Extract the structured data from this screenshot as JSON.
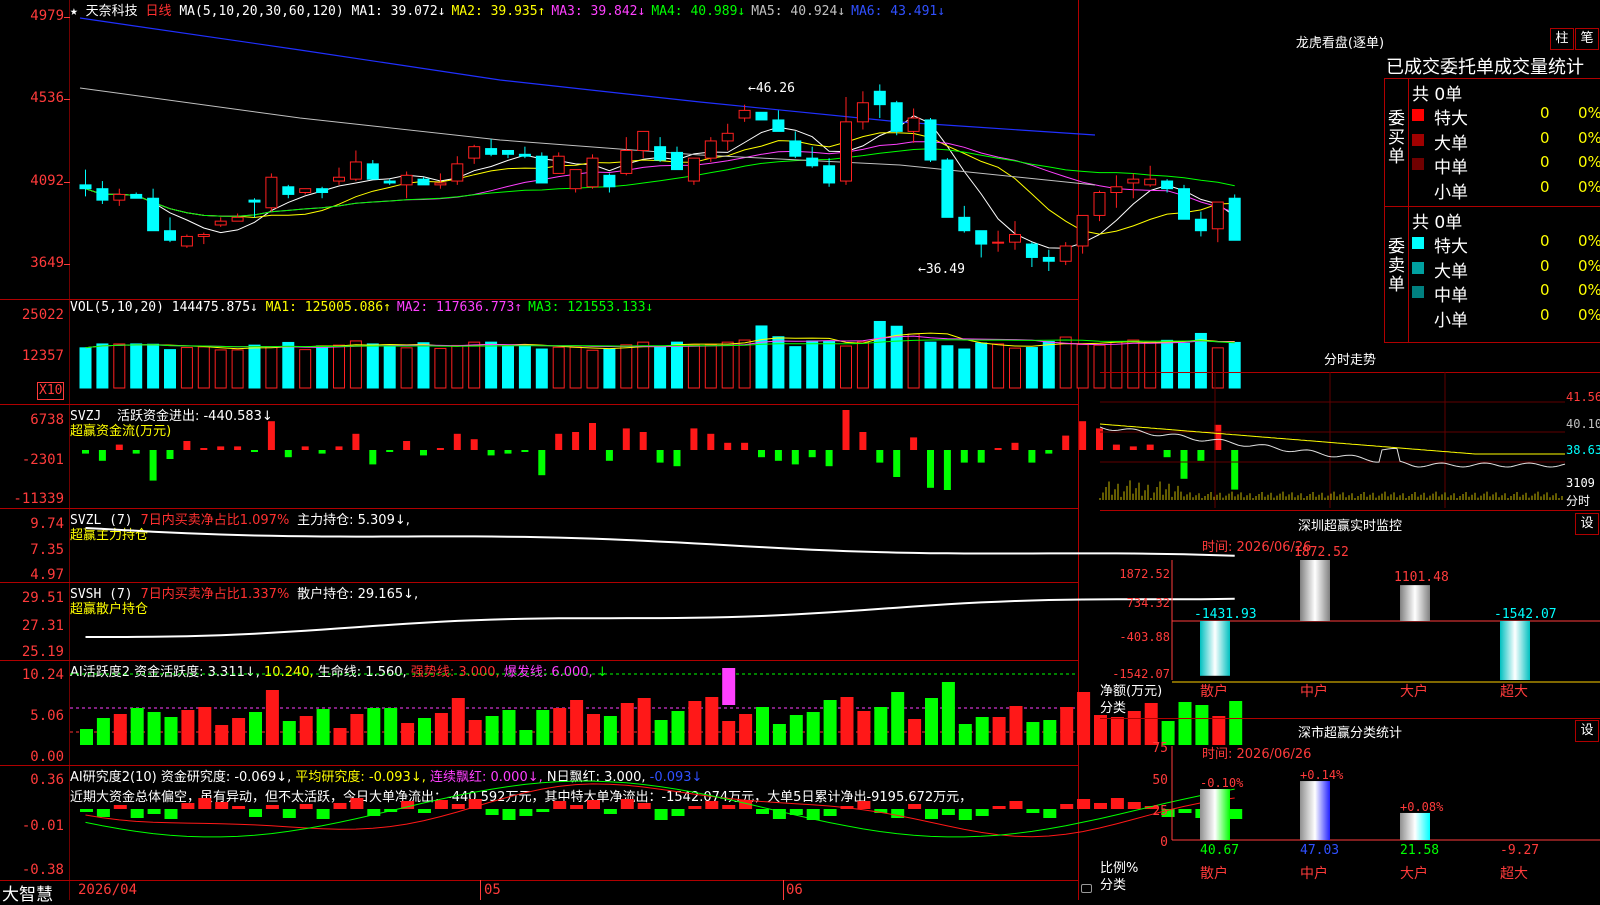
{
  "stock": {
    "name": "天奈科技",
    "period": "日线",
    "star": "★"
  },
  "ma_header": {
    "label": "MA(5,10,20,30,60,120)",
    "items": [
      {
        "text": "MA1: 39.072↓",
        "color": "#ffffff"
      },
      {
        "text": "MA2: 39.935↑",
        "color": "#ffff00"
      },
      {
        "text": "MA3: 39.842↓",
        "color": "#ff40ff"
      },
      {
        "text": "MA4: 40.989↓",
        "color": "#00ff00"
      },
      {
        "text": "MA5: 40.924↓",
        "color": "#c0c0c0"
      },
      {
        "text": "MA6: 43.491↓",
        "color": "#3050ff"
      }
    ]
  },
  "price_axis": [
    "4979",
    "4536",
    "4092",
    "3649"
  ],
  "price_marks": {
    "high": "46.26",
    "low": "36.49"
  },
  "vol_header": {
    "label": "VOL(5,10,20)",
    "value": "144475.875↓",
    "items": [
      {
        "text": "MA1: 125005.086↑",
        "color": "#ffff00"
      },
      {
        "text": "MA2: 117636.773↑",
        "color": "#ff40ff"
      },
      {
        "text": "MA3: 121553.133↓",
        "color": "#00ff00"
      }
    ]
  },
  "vol_axis": [
    "25022",
    "12357"
  ],
  "vol_unit": "X10",
  "svzj": {
    "label": "SVZJ",
    "text": "活跃资金进出: -440.583↓",
    "sub": "超赢资金流(万元)",
    "axis": [
      "6738",
      "-2301",
      "-11339"
    ]
  },
  "svzl": {
    "label": "SVZL (7)",
    "t1": "7日内买卖净占比1.097%",
    "t2": "主力持仓: 5.309↓,",
    "sub": "超赢主力持仓",
    "axis": [
      "9.74",
      "7.35",
      "4.97"
    ]
  },
  "svsh": {
    "label": "SVSH (7)",
    "t1": "7日内买卖净占比1.337%",
    "t2": "散户持仓: 29.165↓,",
    "sub": "超赢散户持仓",
    "axis": [
      "29.51",
      "27.31",
      "25.19"
    ]
  },
  "ai1": {
    "t1": "AI活跃度2 资金活跃度: 3.311↓,",
    "t2": "10.240,",
    "t3": "生命线: 1.560,",
    "t4": "强势线: 3.000,",
    "t5": "爆发线: 6.000,",
    "t6": "↓",
    "axis": [
      "10.24",
      "5.06",
      "0.00"
    ]
  },
  "ai2": {
    "t1": "AI研究度2(10) 资金研究度: -0.069↓,",
    "t2": "平均研究度: -0.093↓,",
    "t3": "连续飘红: 0.000↓,",
    "t4": "N日飘红: 3.000,",
    "t5": "-0.093↓",
    "desc": "近期大资金总体偏空，虽有异动，但不太活跃，今日大单净流出：-440.592万元，其中特大单净流出：-1542.074万元，大单5日累计净出-9195.672万元，",
    "axis": [
      "0.36",
      "-0.01",
      "-0.38"
    ]
  },
  "date_axis": [
    "2026/04",
    "05",
    "06"
  ],
  "brand": "大智慧",
  "right": {
    "lhb_title": "龙虎看盘(逐单)",
    "btn_zhu": "柱",
    "btn_bi": "笔",
    "order_title": "已成交委托单成交量统计",
    "buy": {
      "label": "委买单",
      "total": "共 0单",
      "rows": [
        {
          "name": "特大",
          "v": "0",
          "p": "0%",
          "c": "#ff0000"
        },
        {
          "name": "大单",
          "v": "0",
          "p": "0%",
          "c": "#a00000"
        },
        {
          "name": "中单",
          "v": "0",
          "p": "0%",
          "c": "#700000"
        },
        {
          "name": "小单",
          "v": "0",
          "p": "0%",
          "c": ""
        }
      ]
    },
    "sell": {
      "label": "委卖单",
      "total": "共 0单",
      "rows": [
        {
          "name": "特大",
          "v": "0",
          "p": "0%",
          "c": "#00ffff"
        },
        {
          "name": "大单",
          "v": "0",
          "p": "0%",
          "c": "#00a0a0"
        },
        {
          "name": "中单",
          "v": "0",
          "p": "0%",
          "c": "#008080"
        },
        {
          "name": "小单",
          "v": "0",
          "p": "0%",
          "c": ""
        }
      ]
    },
    "fs_title": "分时走势",
    "fs_axis": [
      "41.56",
      "40.10",
      "38.63"
    ],
    "fs_vol": "3109",
    "fs_unit": "分时",
    "sz_title": "深圳超赢实时监控",
    "set": "设",
    "time": "时间: 2026/06/26",
    "sz_axis": [
      "1872.52",
      "734.32",
      "-403.88",
      "-1542.07"
    ],
    "sz_bars": [
      {
        "cat": "散户",
        "value": "-1431.93"
      },
      {
        "cat": "中户",
        "value": "1872.52"
      },
      {
        "cat": "大户",
        "value": "1101.48"
      },
      {
        "cat": "超大",
        "value": "-1542.07"
      }
    ],
    "sz_ylabel": "净额(万元)",
    "sz_xlabel": "分类",
    "ss_title": "深市超赢分类统计",
    "ss_axis": [
      "75",
      "50",
      "25",
      "0"
    ],
    "ss_bars": [
      {
        "cat": "散户",
        "top": "-0.10%",
        "bottom": "40.67"
      },
      {
        "cat": "中户",
        "top": "+0.14%",
        "bottom": "47.03"
      },
      {
        "cat": "大户",
        "top": "+0.08%",
        "bottom": "21.58"
      },
      {
        "cat": "超大",
        "top": "",
        "bottom": "-9.27"
      }
    ],
    "ss_ylabel": "比例%",
    "ss_xlabel": "分类"
  },
  "chart_data": {
    "type": "candlestick",
    "ohlc": [
      [
        41.0,
        41.8,
        40.4,
        40.8
      ],
      [
        40.8,
        41.2,
        40.0,
        40.2
      ],
      [
        40.2,
        40.8,
        39.9,
        40.5
      ],
      [
        40.5,
        40.6,
        40.3,
        40.3
      ],
      [
        40.3,
        40.8,
        38.6,
        38.6
      ],
      [
        38.6,
        39.3,
        38.0,
        38.1
      ],
      [
        37.8,
        38.4,
        37.7,
        38.3
      ],
      [
        38.3,
        38.5,
        37.9,
        38.4
      ],
      [
        38.9,
        39.3,
        38.8,
        39.1
      ],
      [
        39.1,
        39.5,
        39.1,
        39.3
      ],
      [
        40.2,
        40.3,
        39.3,
        40.1
      ],
      [
        39.8,
        41.6,
        39.6,
        41.4
      ],
      [
        40.9,
        41.0,
        40.3,
        40.5
      ],
      [
        40.6,
        40.8,
        40.5,
        40.8
      ],
      [
        40.8,
        40.9,
        40.3,
        40.6
      ],
      [
        41.2,
        41.9,
        41.0,
        41.4
      ],
      [
        41.3,
        42.8,
        41.2,
        42.2
      ],
      [
        42.1,
        42.3,
        41.3,
        41.3
      ],
      [
        41.2,
        41.3,
        41.0,
        41.1
      ],
      [
        41.0,
        41.7,
        40.3,
        41.5
      ],
      [
        41.3,
        41.4,
        41.0,
        41.0
      ],
      [
        41.0,
        41.6,
        40.8,
        41.1
      ],
      [
        41.2,
        42.5,
        41.0,
        42.1
      ],
      [
        42.4,
        43.1,
        42.1,
        43.0
      ],
      [
        42.9,
        43.4,
        42.5,
        42.6
      ],
      [
        42.8,
        42.8,
        42.4,
        42.6
      ],
      [
        42.6,
        43.0,
        42.4,
        42.5
      ],
      [
        42.5,
        42.7,
        41.1,
        41.1
      ],
      [
        41.6,
        42.7,
        41.6,
        42.5
      ],
      [
        40.8,
        41.7,
        40.6,
        41.8
      ],
      [
        40.9,
        42.6,
        40.8,
        42.4
      ],
      [
        41.5,
        41.6,
        40.6,
        40.9
      ],
      [
        41.6,
        43.5,
        41.5,
        42.8
      ],
      [
        42.8,
        43.6,
        42.4,
        43.8
      ],
      [
        43.0,
        43.5,
        42.2,
        42.3
      ],
      [
        42.7,
        43.0,
        42.1,
        41.8
      ],
      [
        41.2,
        42.3,
        41.0,
        42.4
      ],
      [
        42.4,
        43.5,
        42.2,
        43.3
      ],
      [
        43.3,
        44.2,
        42.8,
        43.7
      ],
      [
        44.5,
        45.2,
        44.3,
        44.9
      ],
      [
        44.8,
        44.8,
        44.4,
        44.4
      ],
      [
        44.4,
        44.9,
        43.8,
        43.8
      ],
      [
        43.3,
        43.8,
        42.4,
        42.5
      ],
      [
        42.4,
        43.0,
        41.9,
        42.0
      ],
      [
        42.0,
        42.4,
        40.9,
        41.1
      ],
      [
        41.2,
        45.6,
        41.0,
        44.3
      ],
      [
        44.3,
        45.9,
        43.9,
        45.3
      ],
      [
        45.9,
        46.26,
        44.5,
        45.2
      ],
      [
        45.3,
        45.4,
        43.6,
        43.8
      ],
      [
        43.8,
        45.0,
        43.2,
        44.5
      ],
      [
        44.4,
        44.5,
        42.2,
        42.3
      ],
      [
        42.3,
        42.4,
        39.3,
        39.3
      ],
      [
        39.3,
        39.9,
        38.5,
        38.6
      ],
      [
        38.6,
        38.6,
        37.2,
        37.9
      ],
      [
        38.0,
        38.6,
        37.5,
        38.0
      ],
      [
        38.0,
        39.1,
        37.6,
        38.4
      ],
      [
        37.9,
        38.0,
        36.7,
        37.2
      ],
      [
        37.2,
        37.6,
        36.49,
        37.0
      ],
      [
        37.0,
        38.0,
        36.8,
        37.8
      ],
      [
        37.8,
        39.3,
        37.4,
        39.4
      ],
      [
        39.4,
        40.7,
        39.1,
        40.6
      ],
      [
        40.6,
        41.5,
        39.8,
        40.9
      ],
      [
        41.1,
        41.6,
        40.3,
        41.3
      ],
      [
        41.0,
        42.0,
        40.9,
        41.3
      ],
      [
        41.2,
        41.3,
        40.6,
        40.8
      ],
      [
        40.8,
        41.0,
        39.3,
        39.2
      ],
      [
        39.2,
        39.6,
        38.3,
        38.6
      ],
      [
        38.7,
        40.0,
        38.0,
        40.1
      ],
      [
        40.3,
        40.5,
        38.1,
        38.1
      ]
    ],
    "volume": [
      1340,
      1470,
      1470,
      1470,
      1460,
      1280,
      1350,
      1370,
      1270,
      1270,
      1430,
      1380,
      1520,
      1280,
      1400,
      1430,
      1570,
      1470,
      1380,
      1340,
      1510,
      1320,
      1420,
      1530,
      1530,
      1390,
      1400,
      1300,
      1360,
      1360,
      1260,
      1300,
      1440,
      1530,
      1400,
      1530,
      1430,
      1440,
      1530,
      1600,
      2070,
      1710,
      1380,
      1570,
      1550,
      1400,
      1540,
      2220,
      2060,
      1800,
      1530,
      1410,
      1300,
      1500,
      1470,
      1330,
      1350,
      1550,
      1700,
      1450,
      1430,
      1530,
      1600,
      1530,
      1590,
      1490,
      1820,
      1340,
      1520
    ]
  }
}
